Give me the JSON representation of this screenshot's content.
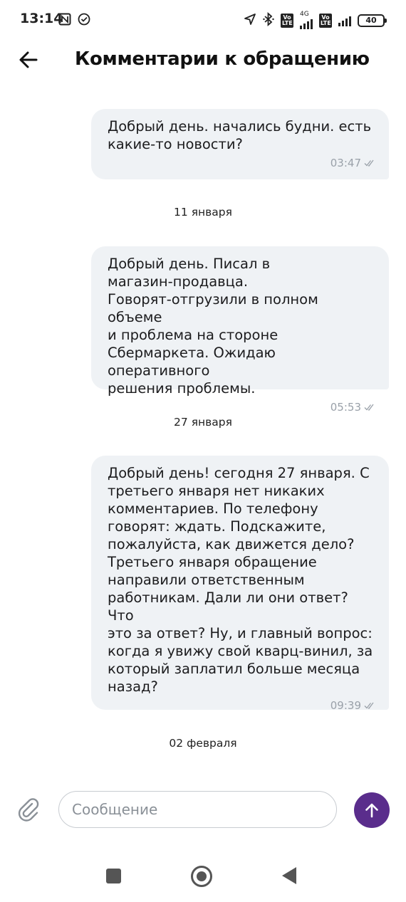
{
  "status_bar": {
    "time": "13:14",
    "icons": [
      "nfc-icon",
      "sync-check-icon",
      "location-icon",
      "bluetooth-icon",
      "volte-icon",
      "signal-icon",
      "volte-icon",
      "signal-icon",
      "battery-icon"
    ],
    "network_label": "4G",
    "lte_label": "Vo LTE",
    "battery_level": "40"
  },
  "header": {
    "title": "Комментарии к обращению",
    "back_icon": "arrow-left-icon"
  },
  "messages": [
    {
      "text": "Добрый день. начались будни. есть\nкакие-то новости?",
      "time": "03:47",
      "status_icon": "double-check-icon"
    },
    {
      "date": "11 января",
      "text": "Добрый день. Писал в\nмагазин-продавца.\nГоворят-отгрузили в полном объеме\nи проблема на стороне\nСбермаркета. Ожидаю оперативного\nрешения проблемы.",
      "time": "05:53",
      "status_icon": "double-check-icon"
    },
    {
      "date": "27 января",
      "text": "Добрый день! сегодня 27 января. С\nтретьего января нет никаких\nкомментариев. По телефону\nговорят: ждать. Подскажите,\nпожалуйста, как движется дело?\nТретьего января обращение\nнаправили ответственным\nработникам. Дали ли они ответ? Что\nэто за ответ? Ну, и главный вопрос:\nкогда я увижу свой кварц-винил, за\nкоторый заплатил больше месяца\nназад?",
      "time": "09:39",
      "status_icon": "double-check-icon"
    }
  ],
  "last_date": "02 февраля",
  "composer": {
    "placeholder": "Сообщение",
    "value": "",
    "attach_icon": "paperclip-icon",
    "send_icon": "arrow-up-icon",
    "send_color": "#5a2d8c"
  },
  "nav_bar": {
    "icons": [
      "recents-square-icon",
      "home-circle-icon",
      "back-triangle-icon"
    ]
  }
}
